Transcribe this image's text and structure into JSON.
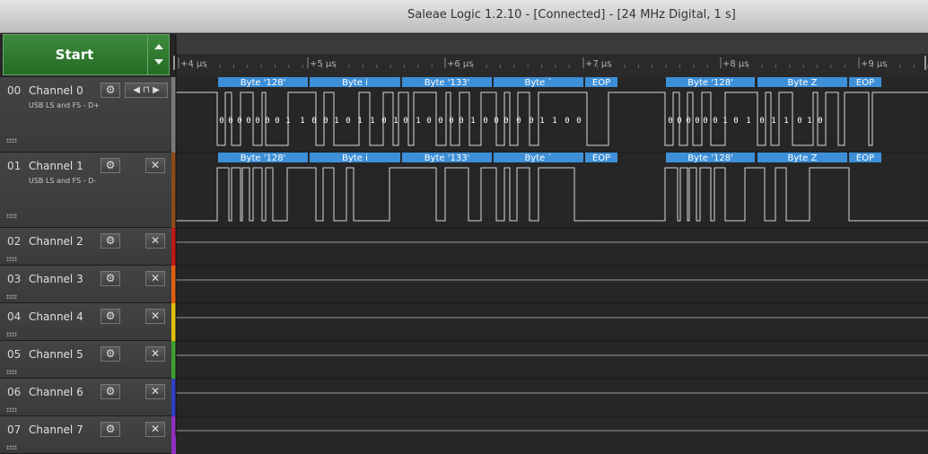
{
  "window": {
    "title": "Saleae Logic 1.2.10 - [Connected] - [24 MHz Digital, 1 s]"
  },
  "start": {
    "label": "Start"
  },
  "timeline": {
    "ticks": [
      "+4 μs",
      "+5 μs",
      "+6 μs",
      "+7 μs",
      "+8 μs",
      "+9 μs"
    ]
  },
  "channels": [
    {
      "index": "00",
      "name": "Channel 0",
      "subtitle": "USB LS and FS - D+",
      "color": "#7a7a7a"
    },
    {
      "index": "01",
      "name": "Channel 1",
      "subtitle": "USB LS and FS - D-",
      "color": "#8a4a1a"
    },
    {
      "index": "02",
      "name": "Channel 2",
      "subtitle": "",
      "color": "#c01818"
    },
    {
      "index": "03",
      "name": "Channel 3",
      "subtitle": "",
      "color": "#e06010"
    },
    {
      "index": "04",
      "name": "Channel 4",
      "subtitle": "",
      "color": "#e0c010"
    },
    {
      "index": "05",
      "name": "Channel 5",
      "subtitle": "",
      "color": "#40a030"
    },
    {
      "index": "06",
      "name": "Channel 6",
      "subtitle": "",
      "color": "#3040c0"
    },
    {
      "index": "07",
      "name": "Channel 7",
      "subtitle": "",
      "color": "#9030c0"
    }
  ],
  "decoder": {
    "labels": [
      "Byte '128'",
      "Byte i",
      "Byte '133'",
      "Byte `",
      "EOP",
      "Byte '128'",
      "Byte Z",
      "EOP"
    ],
    "bits": [
      "0",
      "0",
      "0",
      "0",
      "0",
      "0",
      "0",
      "1",
      "1",
      "0",
      "0",
      "1",
      "0",
      "1",
      "1",
      "0",
      "1",
      "0",
      "1",
      "0",
      "0",
      "0",
      "0",
      "1",
      "0",
      "0",
      "0",
      "0",
      "0",
      "1",
      "1",
      "0",
      "0",
      "0",
      "0",
      "0",
      "0",
      "0",
      "0",
      "1",
      "0",
      "1",
      "0",
      "1",
      "1",
      "0",
      "1",
      "0"
    ]
  }
}
